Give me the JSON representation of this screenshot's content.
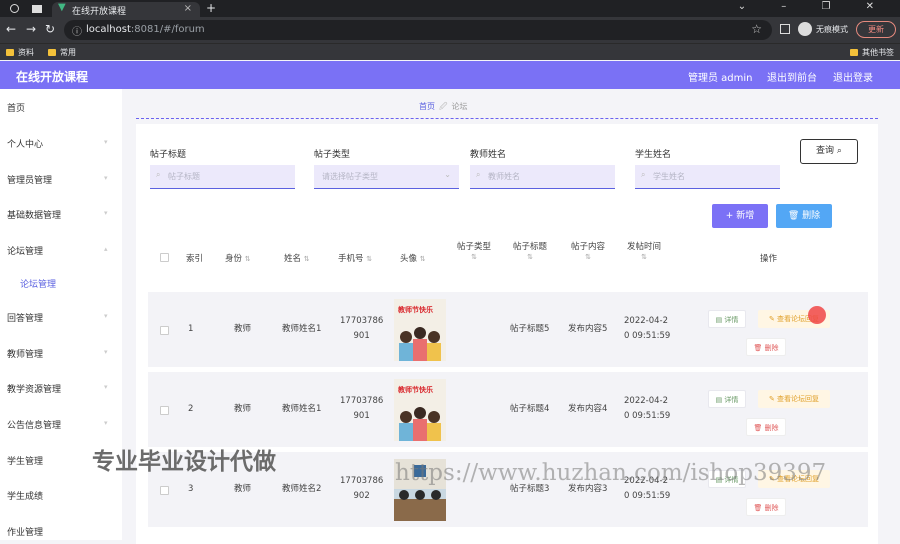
{
  "browser": {
    "active_tab": "在线开放课程",
    "url_host": "localhost",
    "url_path": ":8081/#/forum",
    "incognito_label": "无痕模式",
    "update_label": "更新",
    "bookmarks": [
      "资料",
      "常用"
    ],
    "other_bookmarks": "其他书签"
  },
  "header": {
    "title": "在线开放课程",
    "admin": "管理员 admin",
    "back_front": "退出到前台",
    "logout": "退出登录",
    "accent": "#7a71f5"
  },
  "sidebar": {
    "items": [
      {
        "label": "首页"
      },
      {
        "label": "个人中心"
      },
      {
        "label": "管理员管理"
      },
      {
        "label": "基础数据管理"
      },
      {
        "label": "论坛管理"
      },
      {
        "label": "论坛管理"
      },
      {
        "label": "回答管理"
      },
      {
        "label": "教师管理"
      },
      {
        "label": "教学资源管理"
      },
      {
        "label": "公告信息管理"
      },
      {
        "label": "学生管理"
      },
      {
        "label": "学生成绩"
      },
      {
        "label": "作业管理"
      }
    ]
  },
  "breadcrumb": {
    "home": "首页",
    "current": "论坛"
  },
  "filters": {
    "title_label": "帖子标题",
    "title_ph": "帖子标题",
    "type_label": "帖子类型",
    "type_ph": "请选择帖子类型",
    "teacher_label": "教师姓名",
    "teacher_ph": "教师姓名",
    "student_label": "学生姓名",
    "student_ph": "学生姓名",
    "search": "查询"
  },
  "toolbar": {
    "add": "新增",
    "delete": "删除"
  },
  "table": {
    "columns": [
      "索引",
      "身份",
      "姓名",
      "手机号",
      "头像",
      "帖子类型",
      "帖子标题",
      "帖子内容",
      "发帖时间",
      "操作"
    ],
    "rows": [
      {
        "index": "1",
        "role": "教师",
        "name": "教师姓名1",
        "phone1": "17703786",
        "phone2": "901",
        "type": "",
        "title": "帖子标题5",
        "content": "发布内容5",
        "time1": "2022-04-2",
        "time2": "0 09:51:59"
      },
      {
        "index": "2",
        "role": "教师",
        "name": "教师姓名1",
        "phone1": "17703786",
        "phone2": "901",
        "type": "",
        "title": "帖子标题4",
        "content": "发布内容4",
        "time1": "2022-04-2",
        "time2": "0 09:51:59"
      },
      {
        "index": "3",
        "role": "教师",
        "name": "教师姓名2",
        "phone1": "17703786",
        "phone2": "902",
        "type": "",
        "title": "帖子标题3",
        "content": "发布内容3",
        "time1": "2022-04-2",
        "time2": "0 09:51:59"
      }
    ],
    "actions": {
      "detail": "详情",
      "view": "查看论坛回复",
      "remove": "删除"
    },
    "avatar_banner": "教师节快乐"
  },
  "watermarks": {
    "left": "专业毕业设计代做",
    "right": "https://www.huzhan.com/ishop39397"
  }
}
